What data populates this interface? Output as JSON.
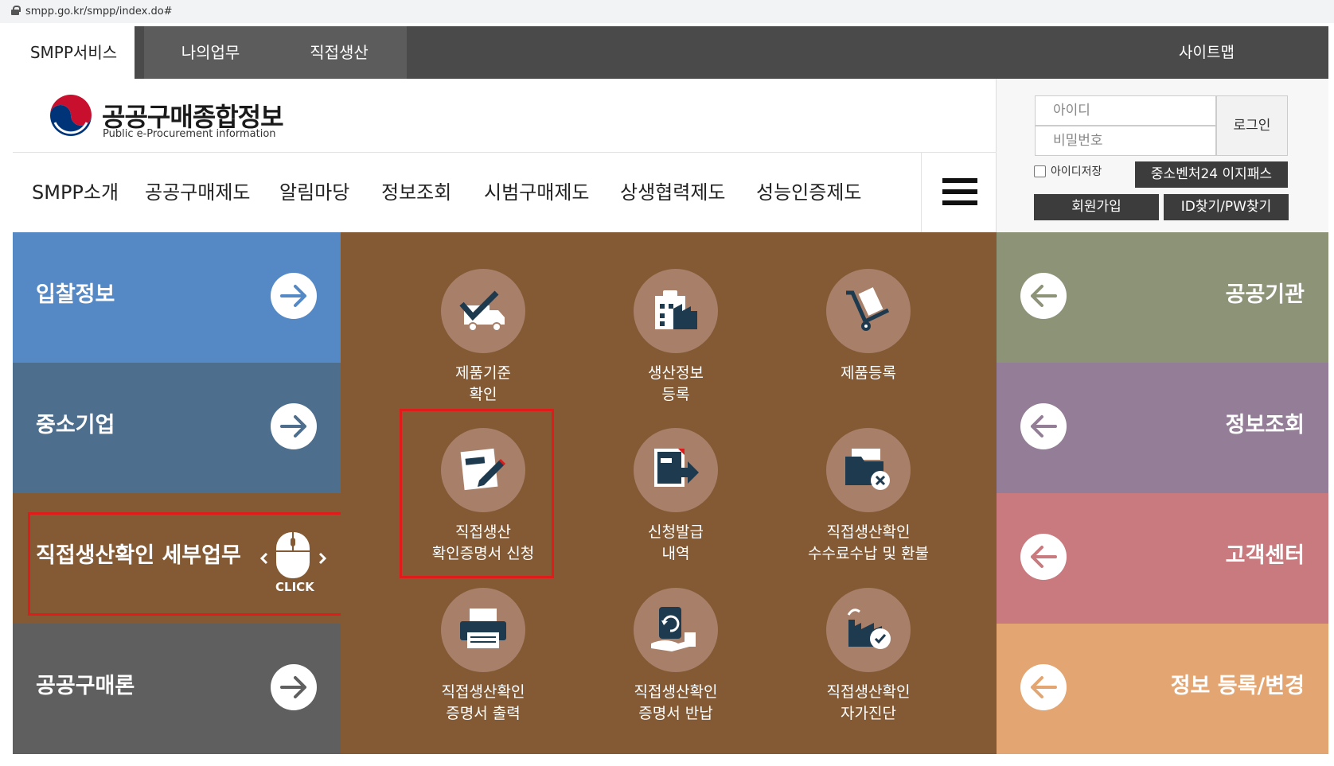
{
  "browser": {
    "url": "smpp.go.kr/smpp/index.do#"
  },
  "topnav": {
    "tabs": [
      "SMPP서비스",
      "나의업무",
      "직접생산"
    ],
    "sitemap": "사이트맵"
  },
  "logo": {
    "title": "공공구매종합정보",
    "subtitle": "Public e-Procurement information"
  },
  "menu": {
    "items": [
      "SMPP소개",
      "공공구매제도",
      "알림마당",
      "정보조회",
      "시범구매제도",
      "상생협력제도",
      "성능인증제도"
    ]
  },
  "login": {
    "id_placeholder": "아이디",
    "pw_placeholder": "비밀번호",
    "login_button": "로그인",
    "save_id": "아이디저장",
    "easypass": "중소벤처24 이지패스",
    "join": "회원가입",
    "find": "ID찾기/PW찾기"
  },
  "left_tiles": [
    "입찰정보",
    "중소기업",
    "직접생산확인 세부업무",
    "공공구매론"
  ],
  "click_label": "CLICK",
  "services": [
    {
      "line1": "제품기준",
      "line2": "확인",
      "icon": "truck-check-icon"
    },
    {
      "line1": "생산정보",
      "line2": "등록",
      "icon": "building-clipboard-icon"
    },
    {
      "line1": "제품등록",
      "line2": "",
      "icon": "hand-truck-icon"
    },
    {
      "line1": "직접생산",
      "line2": "확인증명서 신청",
      "icon": "document-pen-icon"
    },
    {
      "line1": "신청발급",
      "line2": "내역",
      "icon": "document-arrow-icon"
    },
    {
      "line1": "직접생산확인",
      "line2": "수수료수납 및 환불",
      "icon": "folder-cancel-icon"
    },
    {
      "line1": "직접생산확인",
      "line2": "증명서 출력",
      "icon": "printer-icon"
    },
    {
      "line1": "직접생산확인",
      "line2": "증명서 반납",
      "icon": "return-document-icon"
    },
    {
      "line1": "직접생산확인",
      "line2": "자가진단",
      "icon": "factory-check-icon"
    }
  ],
  "right_tiles": [
    "공공기관",
    "정보조회",
    "고객센터",
    "정보 등록/변경"
  ],
  "colors": {
    "left": [
      "#5489c6",
      "#4d6e8c",
      "#845a34",
      "#5f5f5f"
    ],
    "right": [
      "#8c9377",
      "#947d96",
      "#c87a7e",
      "#e3a672"
    ],
    "center": "#845a34",
    "icon_circle": "#a8806a",
    "highlight": "#e11a1a"
  }
}
